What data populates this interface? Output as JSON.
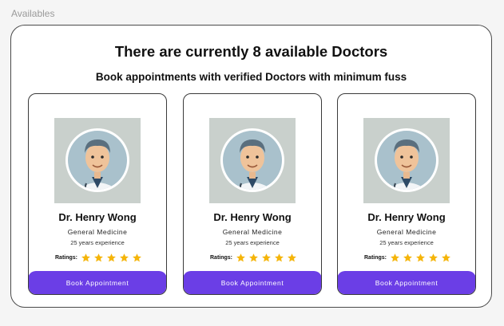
{
  "frame_label": "Availables",
  "panel": {
    "headline": "There are currently 8 available Doctors",
    "subline": "Book appointments with verified Doctors with minimum fuss"
  },
  "doctors": [
    {
      "name": "Dr. Henry Wong",
      "specialty": "General Medicine",
      "experience": "25 years experience",
      "ratings_label": "Ratings:",
      "rating": 5,
      "button_label": "Book Appointment"
    },
    {
      "name": "Dr. Henry Wong",
      "specialty": "General Medicine",
      "experience": "25 years experience",
      "ratings_label": "Ratings:",
      "rating": 5,
      "button_label": "Book Appointment"
    },
    {
      "name": "Dr. Henry Wong",
      "specialty": "General Medicine",
      "experience": "25 years experience",
      "ratings_label": "Ratings:",
      "rating": 5,
      "button_label": "Book Appointment"
    }
  ],
  "colors": {
    "accent": "#6b3ee6",
    "star": "#f5b50a",
    "photo_bg": "#c9d0cc"
  },
  "icons": {
    "star": "star-icon",
    "avatar": "doctor-avatar-image"
  }
}
